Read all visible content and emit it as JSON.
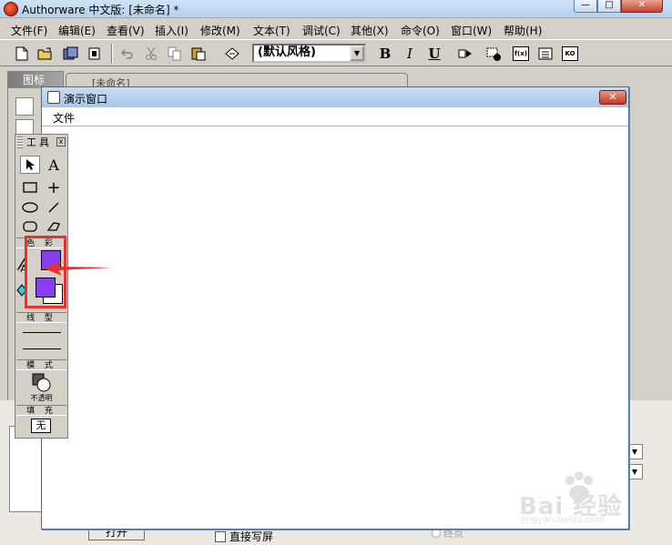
{
  "window": {
    "title": "Authorware 中文版: [未命名] *",
    "min_glyph": "—",
    "max_glyph": "□",
    "close_glyph": "✕"
  },
  "menubar": {
    "items": [
      "文件(F)",
      "编辑(E)",
      "查看(V)",
      "插入(I)",
      "修改(M)",
      "文本(T)",
      "调试(C)",
      "其他(X)",
      "命令(O)",
      "窗口(W)",
      "帮助(H)"
    ]
  },
  "toolbar": {
    "text_style": "(默认风格)",
    "bold": "B",
    "italic": "I",
    "underline": "U",
    "func_label": "f(x)",
    "ko_label": "KO"
  },
  "icon_palette": {
    "title": "图标"
  },
  "design_window": {
    "title": "[未命名]"
  },
  "presentation_window": {
    "title": "演示窗口",
    "close_glyph": "✕",
    "menu_file": "文件"
  },
  "tools_palette": {
    "title": "工具",
    "close_glyph": "x",
    "text_tool": "A",
    "cross_tool": "+",
    "color_section": "色 彩",
    "text_color_letter": "A",
    "line_section": "线 型",
    "mode_section": "模 式",
    "mode_value": "不透明",
    "fill_section": "填 充",
    "fill_value": "无",
    "colors": {
      "line_color": "#8a3cf0",
      "fill_foreground": "#8a3cf0",
      "fill_background": "#ffffff"
    }
  },
  "bottom_panel": {
    "open_button": "打开",
    "direct_write": "直接写屏",
    "endpoint": "终点"
  },
  "watermark": {
    "text": "Bai 经验",
    "sub": "jingyan.baidu.com"
  }
}
